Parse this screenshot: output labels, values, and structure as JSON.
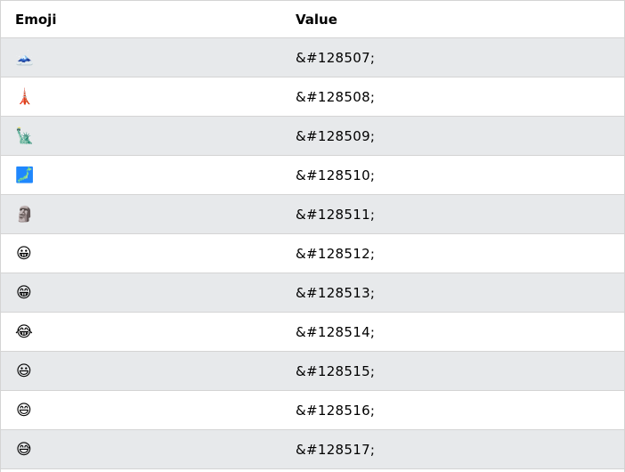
{
  "table": {
    "headers": [
      "Emoji",
      "Value"
    ],
    "rows": [
      {
        "emoji": "🗻",
        "value": "&#128507;"
      },
      {
        "emoji": "🗼",
        "value": "&#128508;"
      },
      {
        "emoji": "🗽",
        "value": "&#128509;"
      },
      {
        "emoji": "🗾",
        "value": "&#128510;"
      },
      {
        "emoji": "🗿",
        "value": "&#128511;"
      },
      {
        "emoji": "😀",
        "value": "&#128512;"
      },
      {
        "emoji": "😁",
        "value": "&#128513;"
      },
      {
        "emoji": "😂",
        "value": "&#128514;"
      },
      {
        "emoji": "😃",
        "value": "&#128515;"
      },
      {
        "emoji": "😄",
        "value": "&#128516;"
      },
      {
        "emoji": "😅",
        "value": "&#128517;"
      }
    ]
  },
  "colors": {
    "shaded_row": "#e7e9eb",
    "border": "#d4d4d4"
  }
}
